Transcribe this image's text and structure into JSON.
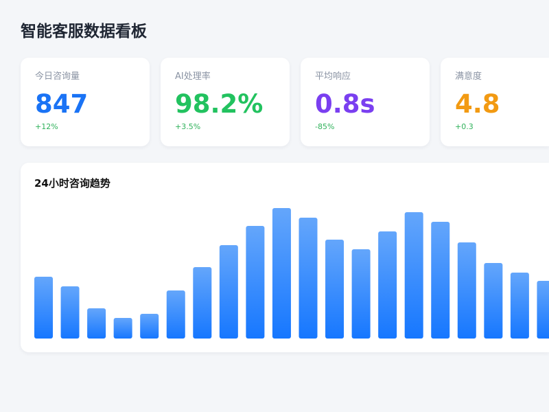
{
  "title": "智能客服数据看板",
  "cards": [
    {
      "label": "今日咨询量",
      "value": "847",
      "delta": "+12%",
      "color": "#1a73f5"
    },
    {
      "label": "AI处理率",
      "value": "98.2%",
      "delta": "+3.5%",
      "color": "#22c25f"
    },
    {
      "label": "平均响应",
      "value": "0.8s",
      "delta": "-85%",
      "color": "#7a3ff0"
    },
    {
      "label": "满意度",
      "value": "4.8",
      "delta": "+0.3",
      "color": "#f29a12"
    }
  ],
  "chart_data": {
    "type": "bar",
    "title": "24小时咨询趋势",
    "xlabel": "",
    "ylabel": "",
    "ylim": [
      0,
      100
    ],
    "values": [
      45,
      38,
      22,
      15,
      18,
      35,
      52,
      68,
      82,
      95,
      88,
      72,
      65,
      78,
      92,
      85,
      70,
      55,
      48,
      42
    ],
    "colors": {
      "top": "#64a6fb",
      "bottom": "#1677ff"
    },
    "grid": false,
    "legend": false
  }
}
